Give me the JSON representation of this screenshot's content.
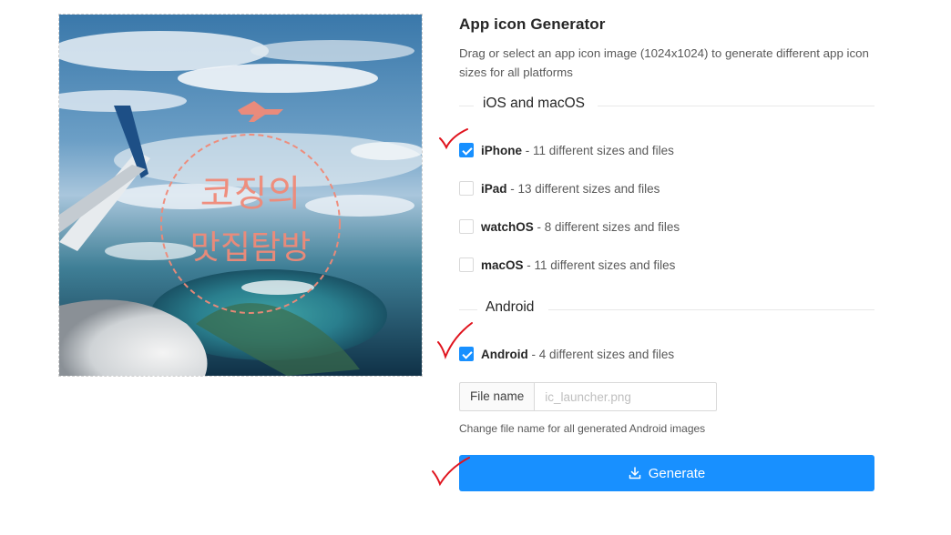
{
  "header": {
    "title": "App icon Generator",
    "description": "Drag or select an app icon image (1024x1024) to generate different app icon sizes for all platforms"
  },
  "dropzone": {
    "logo_line1": "코징의",
    "logo_line2": "맛집탐방"
  },
  "sections": {
    "ios": {
      "title": "iOS and macOS"
    },
    "android": {
      "title": "Android"
    }
  },
  "platforms": {
    "iphone": {
      "name": "iPhone",
      "detail": " - 11 different sizes and files",
      "checked": true
    },
    "ipad": {
      "name": "iPad",
      "detail": " - 13 different sizes and files",
      "checked": false
    },
    "watchos": {
      "name": "watchOS",
      "detail": " - 8 different sizes and files",
      "checked": false
    },
    "macos": {
      "name": "macOS",
      "detail": " - 11 different sizes and files",
      "checked": false
    },
    "android": {
      "name": "Android",
      "detail": " - 4 different sizes and files",
      "checked": true
    }
  },
  "filename": {
    "addon_label": "File name",
    "value": "",
    "placeholder": "ic_launcher.png",
    "hint": "Change file name for all generated Android images"
  },
  "generate": {
    "label": "Generate",
    "icon": "download-icon"
  },
  "colors": {
    "primary": "#1890ff",
    "annotation": "#e0141e",
    "logo": "#f08a78"
  }
}
